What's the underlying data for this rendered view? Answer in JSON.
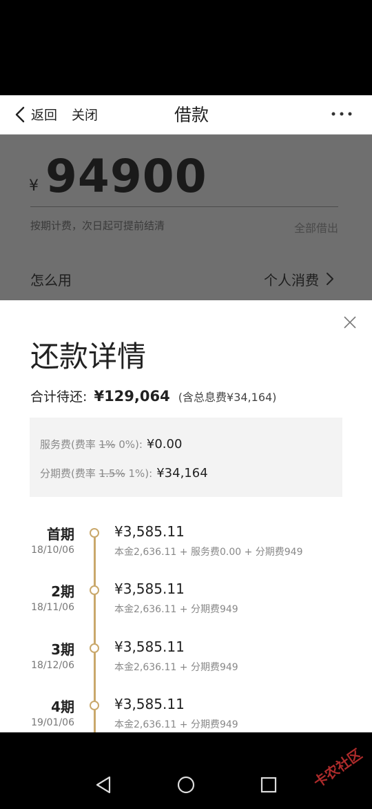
{
  "nav": {
    "back_label": "返回",
    "close_label": "关闭",
    "title": "借款"
  },
  "loan": {
    "currency": "¥",
    "amount": "94900",
    "hint": "按期计费，次日起可提前结清",
    "borrow_all": "全部借出",
    "howto_label": "怎么用",
    "usage_value": "个人消费"
  },
  "sheet": {
    "title": "还款详情",
    "total_label": "合计待还:",
    "total_amount": "¥129,064",
    "total_fee": "(含总息费¥34,164)",
    "fees": [
      {
        "prefix": "服务费(费率 ",
        "old_rate": "1%",
        "new_rate": " 0%):",
        "value": "¥0.00"
      },
      {
        "prefix": "分期费(费率 ",
        "old_rate": "1.5%",
        "new_rate": " 1%):",
        "value": "¥34,164"
      }
    ],
    "installments": [
      {
        "period": "首期",
        "date": "18/10/06",
        "amount": "¥3,585.11",
        "detail": "本金2,636.11 + 服务费0.00 + 分期费949"
      },
      {
        "period": "2期",
        "date": "18/11/06",
        "amount": "¥3,585.11",
        "detail": "本金2,636.11 + 分期费949"
      },
      {
        "period": "3期",
        "date": "18/12/06",
        "amount": "¥3,585.11",
        "detail": "本金2,636.11 + 分期费949"
      },
      {
        "period": "4期",
        "date": "19/01/06",
        "amount": "¥3,585.11",
        "detail": "本金2,636.11 + 分期费949"
      }
    ]
  },
  "watermark": {
    "text": "卡农社区"
  },
  "colors": {
    "accent_gold": "#c9a86b",
    "overlay_gray": "#6f6f6f"
  },
  "icons": [
    "chevron-left-icon",
    "more-icon",
    "chevron-right-icon",
    "close-icon",
    "back-triangle-icon",
    "home-circle-icon",
    "recents-square-icon"
  ]
}
